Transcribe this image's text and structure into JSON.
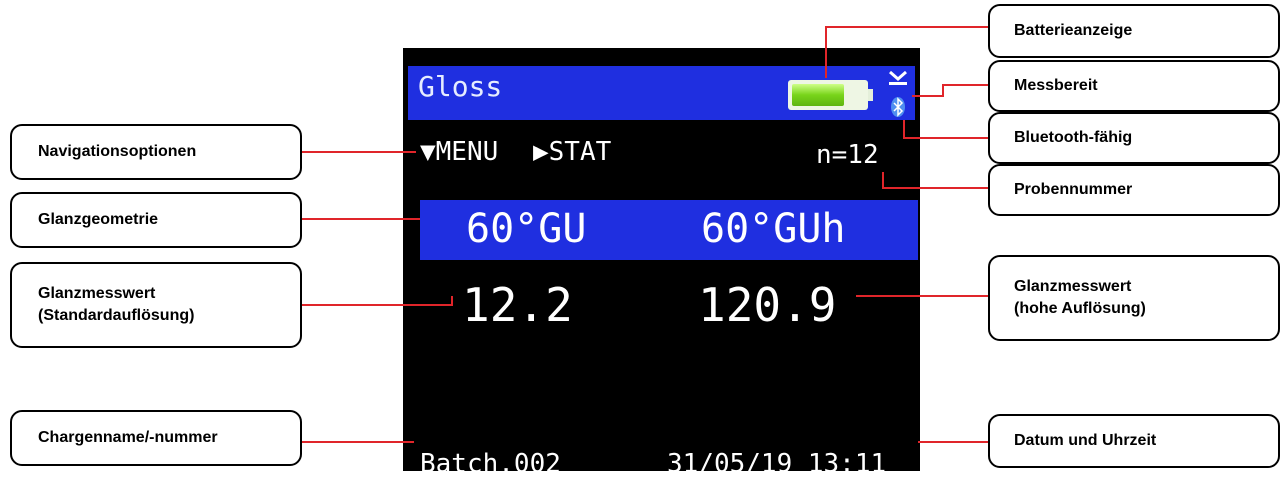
{
  "device": {
    "title": "Gloss",
    "nav_menu": "▼MENU",
    "nav_stat": "▶STAT",
    "sample_count": "n=12",
    "geometry_standard": "60°GU",
    "geometry_high": "60°GUh",
    "value_standard": "12.2",
    "value_high": "120.9",
    "batch": "Batch.002",
    "datetime": "31/05/19 13:11",
    "battery_level": 0.72
  },
  "callouts": {
    "navigation": "Navigationsoptionen",
    "geometry": "Glanzgeometrie",
    "gloss_standard_line1": "Glanzmesswert",
    "gloss_standard_line2": "(Standardauflösung)",
    "batch_name": "Chargenname/-nummer",
    "battery": "Batterieanzeige",
    "ready": "Messbereit",
    "bluetooth": "Bluetooth-fähig",
    "sample_number": "Probennummer",
    "gloss_high_line1": "Glanzmesswert",
    "gloss_high_line2": "(hohe Auflösung)",
    "date_time": "Datum und Uhrzeit"
  },
  "colors": {
    "screen_bg": "#000000",
    "bar_blue": "#1f2fe0",
    "leader_line": "#e0252a",
    "battery_green": "#78d41a"
  }
}
